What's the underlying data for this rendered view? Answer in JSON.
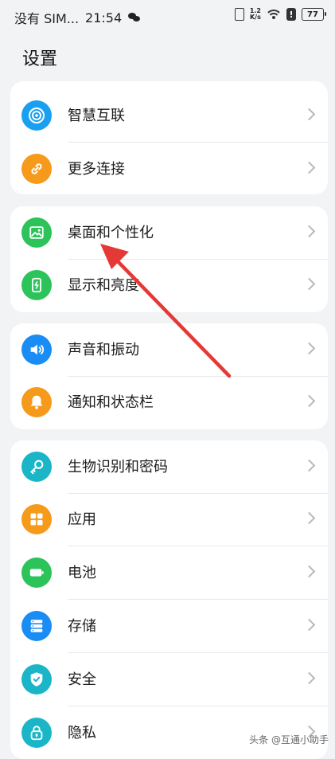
{
  "status_bar": {
    "carrier": "没有 SIM...",
    "time": "21:54",
    "network_speed_top": "1.2",
    "network_speed_bottom": "K/s",
    "battery": "77"
  },
  "page_title": "设置",
  "groups": [
    {
      "items": [
        {
          "label": "智慧互联",
          "icon": "smart-connect-icon",
          "color": "#1aa0f0"
        },
        {
          "label": "更多连接",
          "icon": "link-icon",
          "color": "#f59a1b"
        }
      ]
    },
    {
      "items": [
        {
          "label": "桌面和个性化",
          "icon": "image-icon",
          "color": "#2cc35a"
        },
        {
          "label": "显示和亮度",
          "icon": "display-icon",
          "color": "#2cc35a"
        }
      ]
    },
    {
      "items": [
        {
          "label": "声音和振动",
          "icon": "volume-icon",
          "color": "#1a8cf5"
        },
        {
          "label": "通知和状态栏",
          "icon": "bell-icon",
          "color": "#f59a1b"
        }
      ]
    },
    {
      "items": [
        {
          "label": "生物识别和密码",
          "icon": "key-icon",
          "color": "#1ab6c8"
        },
        {
          "label": "应用",
          "icon": "apps-icon",
          "color": "#f59a1b"
        },
        {
          "label": "电池",
          "icon": "battery-icon",
          "color": "#2cc35a"
        },
        {
          "label": "存储",
          "icon": "storage-icon",
          "color": "#1a8cf5"
        },
        {
          "label": "安全",
          "icon": "shield-icon",
          "color": "#1ab6c8"
        },
        {
          "label": "隐私",
          "icon": "privacy-lock-icon",
          "color": "#1ab6c8"
        }
      ]
    }
  ],
  "watermark": "头条 @互通小助手",
  "annotation_arrow_color": "#e53935"
}
